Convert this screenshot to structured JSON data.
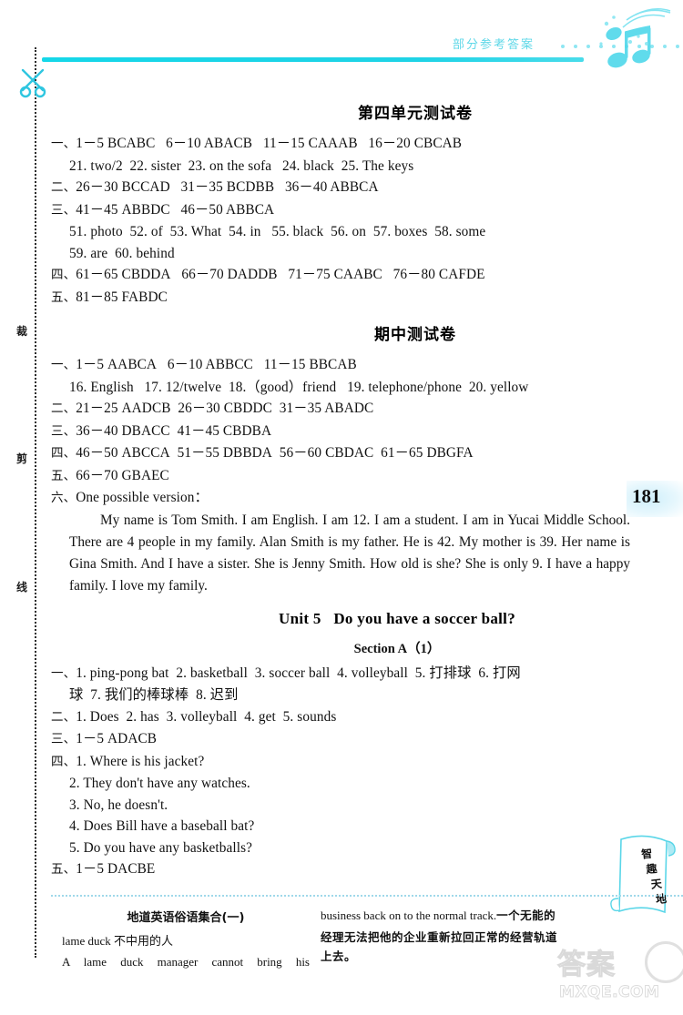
{
  "header": {
    "label": "部分参考答案",
    "page_number": "181"
  },
  "cut_margin": {
    "chars": [
      "裁",
      "剪",
      "线"
    ],
    "scissors_icon": "scissors-icon"
  },
  "sections": [
    {
      "title": "第四单元测试卷",
      "lines": [
        {
          "marker": "一、",
          "text": "1－5 BCABC   6－10 ABACB   11－15 CAAAB   16－20 CBCAB",
          "indent": false
        },
        {
          "marker": "",
          "text": "21. two/2  22. sister  23. on the sofa   24. black  25. The keys",
          "indent": true
        },
        {
          "marker": "二、",
          "text": "26－30 BCCAD   31－35 BCDBB   36－40 ABBCA",
          "indent": false
        },
        {
          "marker": "三、",
          "text": "41－45 ABBDC   46－50 ABBCA",
          "indent": false
        },
        {
          "marker": "",
          "text": "51. photo  52. of  53. What  54. in   55. black  56. on  57. boxes  58. some",
          "indent": true
        },
        {
          "marker": "",
          "text": "59. are  60. behind",
          "indent": true
        },
        {
          "marker": "四、",
          "text": "61－65 CBDDA   66－70 DADDB   71－75 CAABC   76－80 CAFDE",
          "indent": false
        },
        {
          "marker": "五、",
          "text": "81－85 FABDC",
          "indent": false
        }
      ]
    },
    {
      "title": "期中测试卷",
      "lines": [
        {
          "marker": "一、",
          "text": "1－5 AABCA   6－10 ABBCC   11－15 BBCAB",
          "indent": false
        },
        {
          "marker": "",
          "text": "16. English   17. 12/twelve  18.（good）friend   19. telephone/phone  20. yellow",
          "indent": true
        },
        {
          "marker": "二、",
          "text": "21－25 AADCB  26－30 CBDDC  31－35 ABADC",
          "indent": false
        },
        {
          "marker": "三、",
          "text": "36－40 DBACC  41－45 CBDBA",
          "indent": false
        },
        {
          "marker": "四、",
          "text": "46－50 ABCCA  51－55 DBBDA  56－60 CBDAC  61－65 DBGFA",
          "indent": false
        },
        {
          "marker": "五、",
          "text": "66－70 GBAEC",
          "indent": false
        },
        {
          "marker": "六、",
          "text": "One possible version：",
          "indent": false
        }
      ],
      "paragraph": "My name is Tom Smith. I am English. I am 12. I am a student. I am in Yucai Middle School. There are 4 people in my family. Alan Smith is my father. He is 42. My mother is 39. Her name is Gina Smith. And I have a sister. She is Jenny Smith. How old is she? She is only 9. I have a happy family. I love my family."
    },
    {
      "title": "Unit 5   Do you have a soccer ball?",
      "subtitle": "Section A（1）",
      "lines": [
        {
          "marker": "一、",
          "text": "1. ping-pong bat  2. basketball  3. soccer ball  4. volleyball  5. 打排球  6. 打网",
          "indent": false
        },
        {
          "marker": "",
          "text": "球  7. 我们的棒球棒  8. 迟到",
          "indent": true
        },
        {
          "marker": "二、",
          "text": "1. Does  2. has  3. volleyball  4. get  5. sounds",
          "indent": false
        },
        {
          "marker": "三、",
          "text": "1－5 ADACB",
          "indent": false
        },
        {
          "marker": "四、",
          "text": "1. Where is his jacket?",
          "indent": false
        },
        {
          "marker": "",
          "text": "2. They don't have any watches.",
          "indent": true
        },
        {
          "marker": "",
          "text": "3. No, he doesn't.",
          "indent": true
        },
        {
          "marker": "",
          "text": "4. Does Bill have a baseball bat?",
          "indent": true
        },
        {
          "marker": "",
          "text": "5. Do you have any basketballs?",
          "indent": true
        },
        {
          "marker": "五、",
          "text": "1－5 DACBE",
          "indent": false
        }
      ]
    }
  ],
  "fun_box": {
    "title": "地道英语俗语集合(一)",
    "entry_head": "lame duck 不中用的人",
    "example_en_left": "A lame duck manager cannot bring his",
    "example_en_right": "business back on to the normal track.",
    "translation_head": "一个无能的",
    "translation_body": "经理无法把他的企业重新拉回正常的经营轨道",
    "translation_tail": "上去。"
  },
  "scroll": {
    "chars": [
      "智",
      "趣",
      "天",
      "地"
    ]
  },
  "watermark": {
    "cn": "答案",
    "en": "MXQE.COM"
  },
  "colors": {
    "accent_cyan": "#15d7e8",
    "header_text": "#5fd8e8",
    "page_tint": "#cfeffb"
  }
}
